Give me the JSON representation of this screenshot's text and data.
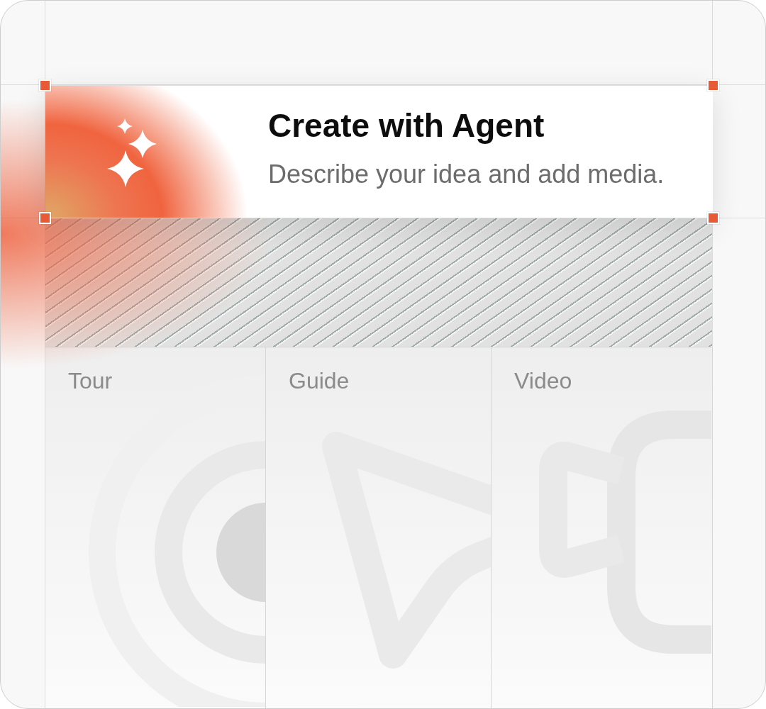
{
  "card": {
    "title": "Create with Agent",
    "subtitle": "Describe your idea and add media.",
    "selected": true
  },
  "tiles": [
    {
      "label": "Tour",
      "kind": "target"
    },
    {
      "label": "Guide",
      "kind": "pointer"
    },
    {
      "label": "Video",
      "kind": "camera"
    }
  ]
}
